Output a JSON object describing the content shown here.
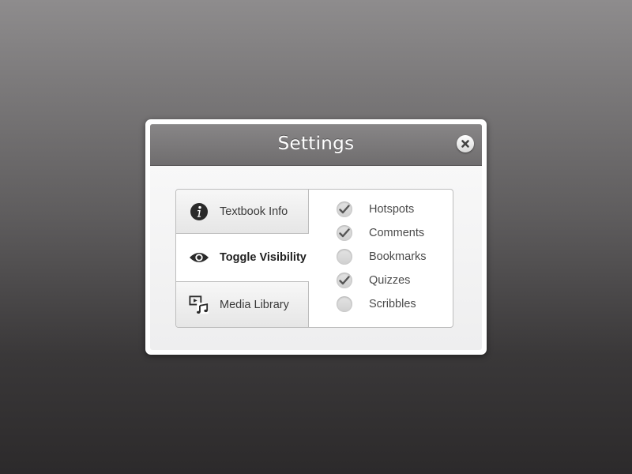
{
  "dialog": {
    "title": "Settings",
    "close_icon": "close-icon"
  },
  "tabs": [
    {
      "label": "Textbook Info",
      "icon": "info-icon",
      "active": false
    },
    {
      "label": "Toggle Visibility",
      "icon": "eye-icon",
      "active": true
    },
    {
      "label": "Media Library",
      "icon": "media-library-icon",
      "active": false
    }
  ],
  "options": [
    {
      "label": "Hotspots",
      "checked": true
    },
    {
      "label": "Comments",
      "checked": true
    },
    {
      "label": "Bookmarks",
      "checked": false
    },
    {
      "label": "Quizzes",
      "checked": true
    },
    {
      "label": "Scribbles",
      "checked": false
    }
  ],
  "colors": {
    "titlebar": "#7c7a7b",
    "icon": "#2a2a2a",
    "checkmark": "#555555"
  }
}
